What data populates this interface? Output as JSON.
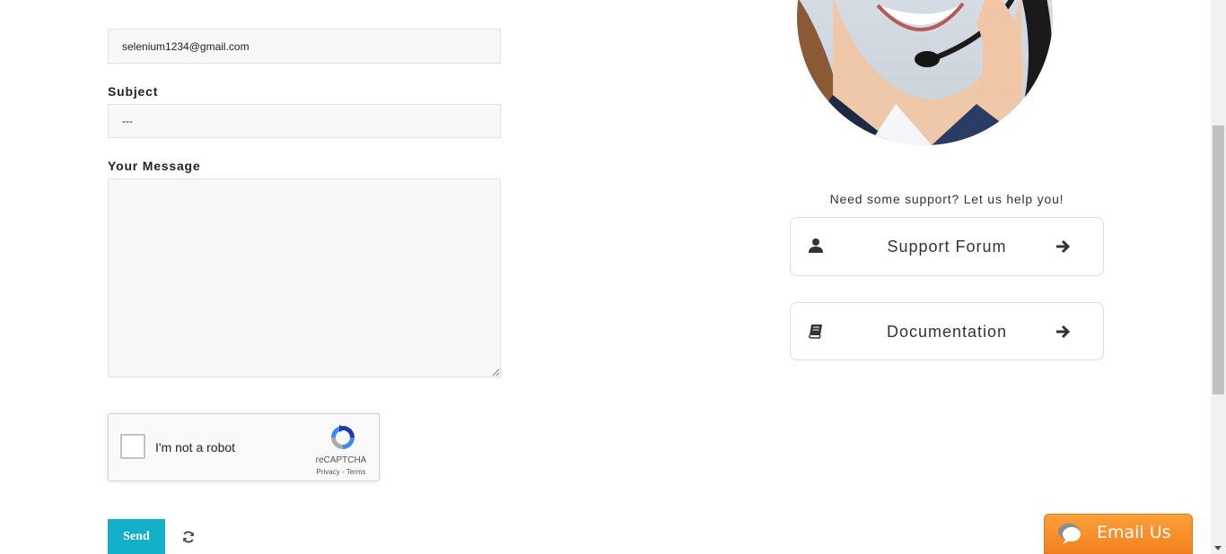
{
  "form": {
    "email_value": "selenium1234@gmail.com",
    "subject_label": "Subject",
    "subject_value": "---",
    "message_label": "Your Message",
    "message_value": ""
  },
  "captcha": {
    "label": "I'm not a robot",
    "brand": "reCAPTCHA",
    "links": "Privacy - Terms"
  },
  "actions": {
    "send_label": "Send",
    "refresh_icon": "refresh-icon"
  },
  "support": {
    "heading": "Need some support? Let us help you!",
    "cards": [
      {
        "label": "Support Forum",
        "icon": "user-icon"
      },
      {
        "label": "Documentation",
        "icon": "book-icon"
      }
    ]
  },
  "widget": {
    "email_us_label": "Email Us",
    "accent": "#f4811f"
  },
  "colors": {
    "send_button": "#13b0c9",
    "input_bg": "#f8f8f8"
  }
}
